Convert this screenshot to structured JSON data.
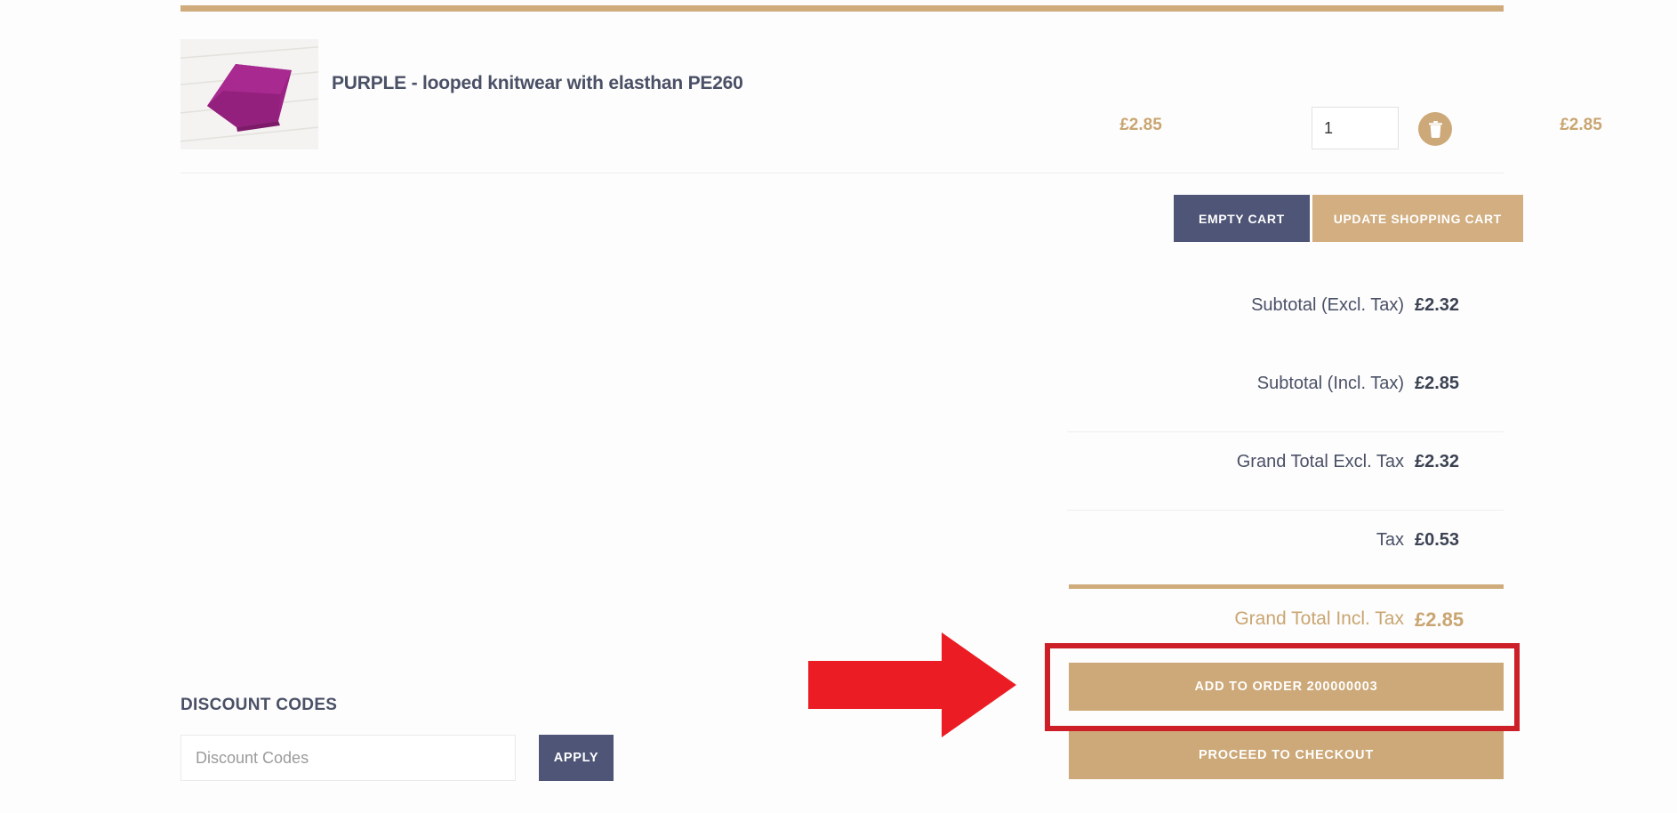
{
  "cart": {
    "product": {
      "name": "PURPLE - looped knitwear with elasthan PE260",
      "unit_price": "£2.85",
      "qty": "1",
      "line_total": "£2.85",
      "image_alt": "folded purple knitwear fabric on white wood planks",
      "delete_icon": "trash-icon"
    },
    "actions": {
      "empty_cart": "EMPTY CART",
      "update_cart": "UPDATE SHOPPING CART"
    }
  },
  "totals": [
    {
      "label": "Subtotal (Excl. Tax)",
      "value": "£2.32"
    },
    {
      "label": "Subtotal (Incl. Tax)",
      "value": "£2.85"
    },
    {
      "label": "Grand Total Excl. Tax",
      "value": "£2.32"
    },
    {
      "label": "Tax",
      "value": "£0.53"
    },
    {
      "label": "Grand Total Incl. Tax",
      "value": "£2.85"
    }
  ],
  "checkout": {
    "add_to_order": "ADD TO ORDER 200000003",
    "proceed": "PROCEED TO CHECKOUT"
  },
  "discount": {
    "title": "DISCOUNT CODES",
    "placeholder": "Discount Codes",
    "value": "",
    "apply": "APPLY"
  },
  "colors": {
    "gold": "#d0ab7c",
    "gold_button": "#cda878",
    "dark_blue": "#4e5577",
    "text_dark": "#4a5066",
    "highlight_red": "#cc1f28"
  }
}
